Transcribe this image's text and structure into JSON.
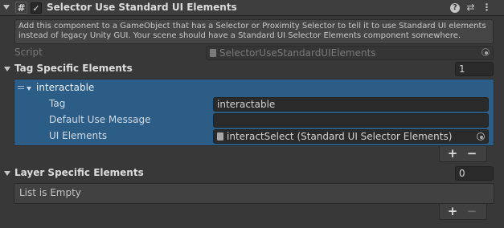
{
  "header": {
    "title": "Selector Use Standard UI Elements",
    "enabled": true,
    "icons": [
      "hash-script-icon",
      "help-icon",
      "preset-icon",
      "more-icon"
    ]
  },
  "help_text": "Add this component to a GameObject that has a Selector or Proximity Selector to tell it to use Standard UI elements instead of legacy Unity GUI. Your scene should have a Standard UI Selector Elements component somewhere.",
  "script": {
    "label": "Script",
    "value": "SelectorUseStandardUIElements"
  },
  "tag_section": {
    "title": "Tag Specific Elements",
    "count": "1",
    "element": {
      "name": "interactable",
      "fields": [
        {
          "label": "Tag",
          "value": "interactable"
        },
        {
          "label": "Default Use Message",
          "value": ""
        },
        {
          "label": "UI Elements",
          "value": "interactSelect (Standard UI Selector Elements)"
        }
      ]
    },
    "add_label": "+",
    "remove_label": "−"
  },
  "layer_section": {
    "title": "Layer Specific Elements",
    "count": "0",
    "empty_text": "List is Empty",
    "add_label": "+",
    "remove_label": "−"
  },
  "colors": {
    "background": "#383838",
    "selection": "#2c5d87",
    "field": "#2a2a2a"
  }
}
